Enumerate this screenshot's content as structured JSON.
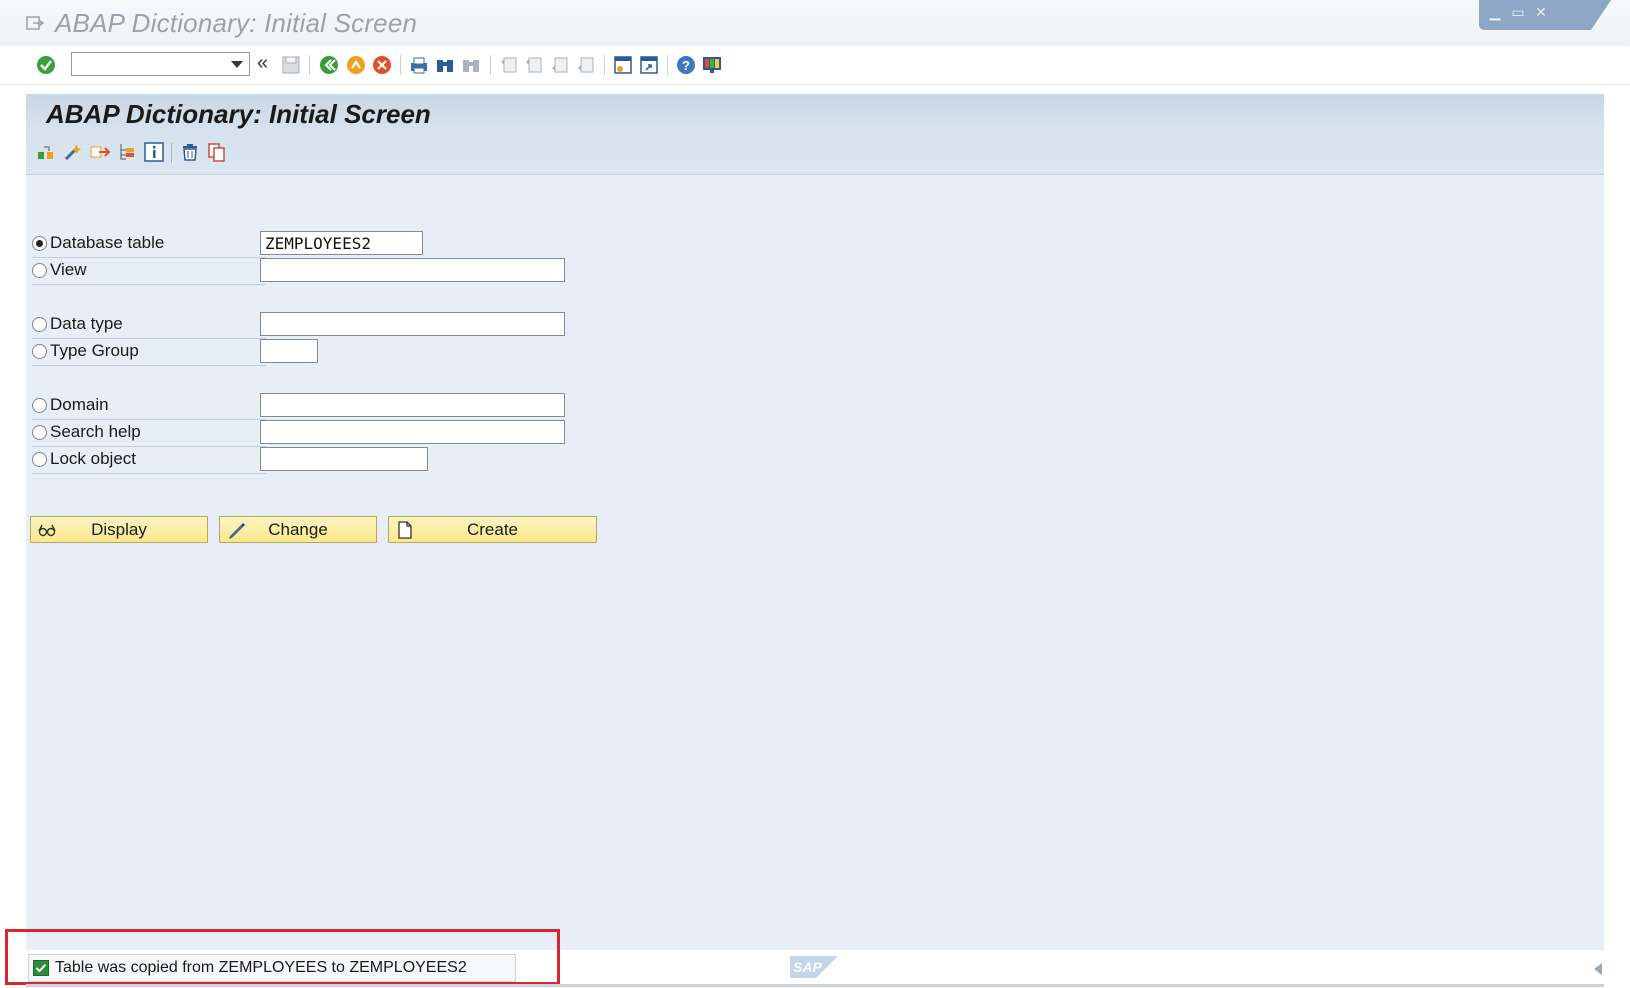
{
  "window": {
    "title": "ABAP Dictionary: Initial Screen",
    "controls": [
      "minimize",
      "maximize",
      "close"
    ]
  },
  "standard_toolbar": {
    "command_field_value": "",
    "icons": [
      "enter-icon",
      "back-icon",
      "exit-icon",
      "cancel-icon",
      "print-icon",
      "find-icon",
      "find-next-icon",
      "first-page-icon",
      "previous-page-icon",
      "next-page-icon",
      "last-page-icon",
      "create-session-icon",
      "shortcut-icon",
      "help-icon",
      "customize-layout-icon"
    ],
    "history_label": "«"
  },
  "screen": {
    "title": "ABAP Dictionary: Initial Screen",
    "app_toolbar_icons": [
      "other-object-icon",
      "check-icon",
      "activate-icon",
      "where-used-icon",
      "information-icon",
      "delete-icon",
      "copy-icon"
    ]
  },
  "form": {
    "selected": "database_table",
    "rows": [
      {
        "key": "database_table",
        "label": "Database table",
        "value": "ZEMPLOYEES2"
      },
      {
        "key": "view",
        "label": "View",
        "value": ""
      },
      {
        "key": "data_type",
        "label": "Data type",
        "value": ""
      },
      {
        "key": "type_group",
        "label": "Type Group",
        "value": ""
      },
      {
        "key": "domain",
        "label": "Domain",
        "value": ""
      },
      {
        "key": "search_help",
        "label": "Search help",
        "value": ""
      },
      {
        "key": "lock_object",
        "label": "Lock object",
        "value": ""
      }
    ]
  },
  "buttons": {
    "display": "Display",
    "change": "Change",
    "create": "Create"
  },
  "status": {
    "type": "success",
    "message": "Table was copied from ZEMPLOYEES to ZEMPLOYEES2"
  },
  "branding": {
    "logo_text": "SAP"
  },
  "colors": {
    "button_fill": "#fbe889",
    "highlight_border": "#d7262d",
    "success_green": "#2e8b3a",
    "content_bg": "#e7eef5"
  }
}
